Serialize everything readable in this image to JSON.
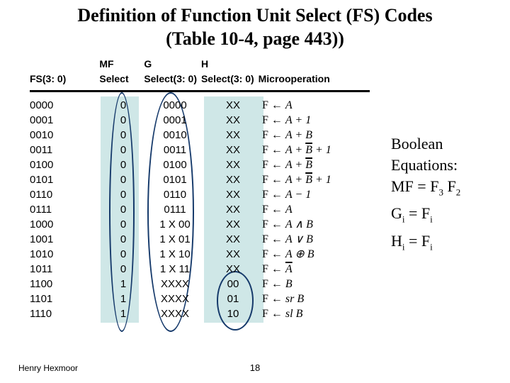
{
  "title_l1": "Definition of Function Unit Select (FS) Codes",
  "title_l2": "(Table 10-4, page 443))",
  "headers": {
    "fs": "FS(3: 0)",
    "mf_l1": "MF",
    "mf_l2": "Select",
    "g_l1": "G",
    "g_l2": "Select(3: 0)",
    "h_l1": "H",
    "h_l2": "Select(3: 0)",
    "micro": "Microoperation"
  },
  "rows": [
    {
      "fs": "0000",
      "mf": "0",
      "g": "0000",
      "h": "XX"
    },
    {
      "fs": "0001",
      "mf": "0",
      "g": "0001",
      "h": "XX"
    },
    {
      "fs": "0010",
      "mf": "0",
      "g": "0010",
      "h": "XX"
    },
    {
      "fs": "0011",
      "mf": "0",
      "g": "0011",
      "h": "XX"
    },
    {
      "fs": "0100",
      "mf": "0",
      "g": "0100",
      "h": "XX"
    },
    {
      "fs": "0101",
      "mf": "0",
      "g": "0101",
      "h": "XX"
    },
    {
      "fs": "0110",
      "mf": "0",
      "g": "0110",
      "h": "XX"
    },
    {
      "fs": "0111",
      "mf": "0",
      "g": "0111",
      "h": "XX"
    },
    {
      "fs": "1000",
      "mf": "0",
      "g": "1 X 00",
      "h": "XX"
    },
    {
      "fs": "1001",
      "mf": "0",
      "g": "1 X 01",
      "h": "XX"
    },
    {
      "fs": "1010",
      "mf": "0",
      "g": "1 X 10",
      "h": "XX"
    },
    {
      "fs": "1011",
      "mf": "0",
      "g": "1 X 11",
      "h": "XX"
    },
    {
      "fs": "1100",
      "mf": "1",
      "g": "XXXX",
      "h": "00"
    },
    {
      "fs": "1101",
      "mf": "1",
      "g": "XXXX",
      "h": "01"
    },
    {
      "fs": "1110",
      "mf": "1",
      "g": "XXXX",
      "h": "10"
    }
  ],
  "ops": {
    "r0": "A",
    "r1": "A + 1",
    "r2": "A + B",
    "r3_pre": "A + ",
    "r3_bar": "B",
    "r3_post": " + 1",
    "r4_pre": "A + ",
    "r4_bar": "B",
    "r5_pre": "A + ",
    "r5_bar": "B",
    "r5_post": " + 1",
    "r6": "A − 1",
    "r7": "A",
    "r8": "A ∧ B",
    "r9": "A ∨ B",
    "r10": "A ⊕ B",
    "r11_bar": "A",
    "r12": "B",
    "r13": "sr B",
    "r14": "sl B"
  },
  "side": {
    "l1": "Boolean",
    "l2": "Equations:",
    "mf": "MF = F",
    "mf_s1": "3",
    "mf_mid": " F",
    "mf_s2": "2",
    "g": "G",
    "g_i": "i",
    "g_mid": " = F",
    "g_i2": "i",
    "h": "H",
    "h_i": "i",
    "h_mid": " = F",
    "h_i2": "i"
  },
  "footer_author": "Henry Hexmoor",
  "footer_page": "18"
}
